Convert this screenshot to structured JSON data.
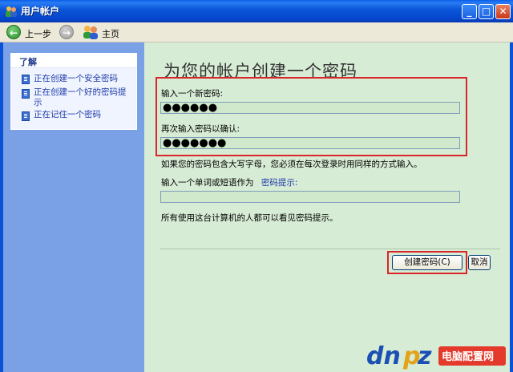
{
  "window": {
    "title": "用户帐户"
  },
  "toolbar": {
    "back_label": "上一步",
    "home_label": "主页"
  },
  "sidebar": {
    "panel_title": "了解",
    "tasks": [
      {
        "label": "正在创建一个安全密码"
      },
      {
        "label": "正在创建一个好的密码提示"
      },
      {
        "label": "正在记住一个密码"
      }
    ]
  },
  "main": {
    "heading": "为您的帐户创建一个密码",
    "new_password_label": "输入一个新密码:",
    "new_password_value": "●●●●●●",
    "confirm_label": "再次输入密码以确认:",
    "confirm_value": "●●●●●●●",
    "case_note": "如果您的密码包含大写字母，您必须在每次登录时用同样的方式输入。",
    "hint_label": "输入一个单词或短语作为",
    "hint_link": "密码提示:",
    "hint_value": "",
    "hint_note": "所有使用这台计算机的人都可以看见密码提示。",
    "create_button": "创建密码(C)",
    "cancel_button": "取消"
  },
  "watermark": {
    "text": "dnpz.net",
    "sub": "电脑配置网"
  },
  "colors": {
    "titlebar": "#0545cc",
    "sidebar": "#7aa1e6",
    "main_bg": "#d7ecd5",
    "highlight": "#d9262a",
    "link": "#1d3ba8"
  }
}
